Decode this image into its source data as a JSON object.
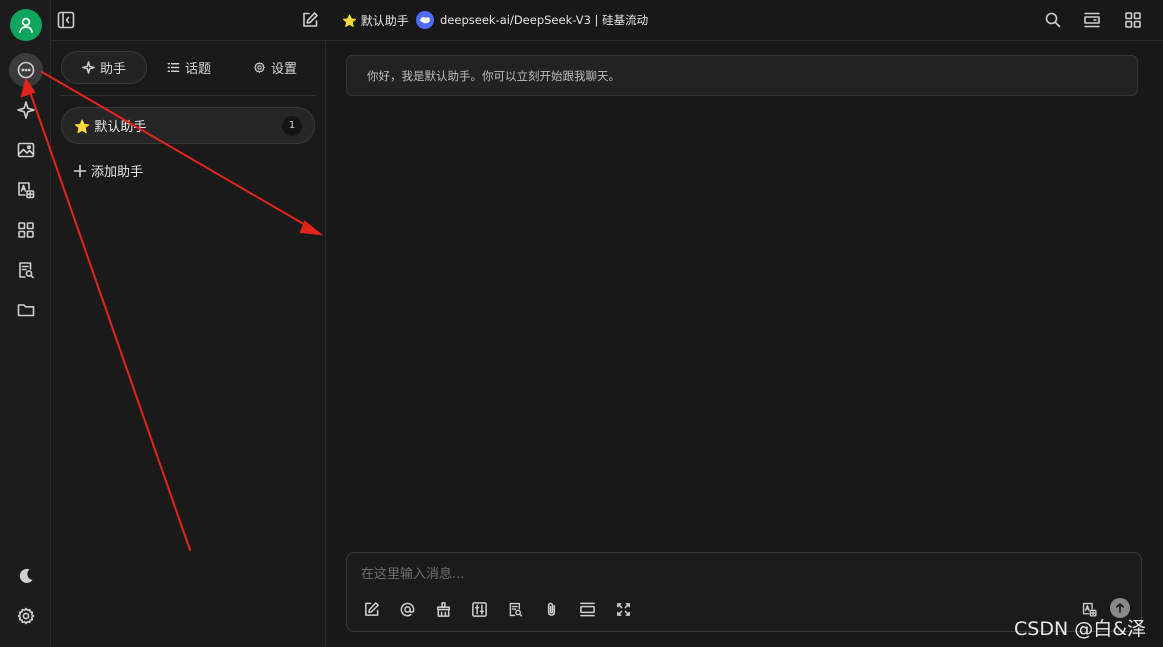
{
  "topbar": {
    "assistant_title": "⭐ 默认助手",
    "model_name": "deepseek-ai/DeepSeek-V3 | 硅基流动"
  },
  "sidebar": {
    "icons": [
      "user-avatar",
      "chat-icon",
      "sparkle-icon",
      "image-icon",
      "translate-icon",
      "apps-icon",
      "knowledge-icon",
      "folder-icon",
      "moon-icon",
      "settings-icon"
    ]
  },
  "panel": {
    "tabs": [
      {
        "label": "助手",
        "icon": "sparkle-icon",
        "active": true
      },
      {
        "label": "话题",
        "icon": "list-icon",
        "active": false
      },
      {
        "label": "设置",
        "icon": "gear-icon",
        "active": false
      }
    ],
    "assistant": {
      "name": "⭐ 默认助手",
      "count": "1"
    },
    "add_label": "添加助手"
  },
  "main": {
    "greeting": "你好，我是默认助手。你可以立刻开始跟我聊天。",
    "input_placeholder": "在这里输入消息..."
  },
  "watermark": "CSDN @白&泽",
  "colors": {
    "background": "#181818",
    "avatar": "#10a45c",
    "model_logo": "#4d6bfe",
    "annotation_arrow": "#e3241b"
  }
}
